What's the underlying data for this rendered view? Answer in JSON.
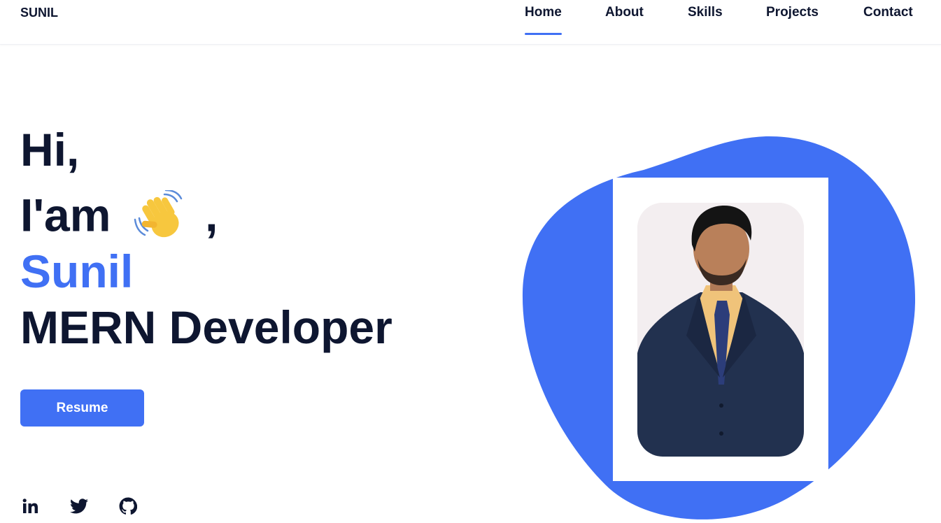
{
  "header": {
    "logo": "SUNIL",
    "nav": [
      {
        "label": "Home",
        "active": true
      },
      {
        "label": "About",
        "active": false
      },
      {
        "label": "Skills",
        "active": false
      },
      {
        "label": "Projects",
        "active": false
      },
      {
        "label": "Contact",
        "active": false
      }
    ]
  },
  "hero": {
    "greeting": "Hi,",
    "intro": "I'am",
    "intro_suffix": ",",
    "name": "Sunil",
    "role": "MERN Developer",
    "resume_label": "Resume"
  },
  "social": [
    "linkedin-icon",
    "twitter-icon",
    "github-icon"
  ],
  "colors": {
    "accent": "#4070f4",
    "text": "#0e1630",
    "background": "#ffffff"
  }
}
